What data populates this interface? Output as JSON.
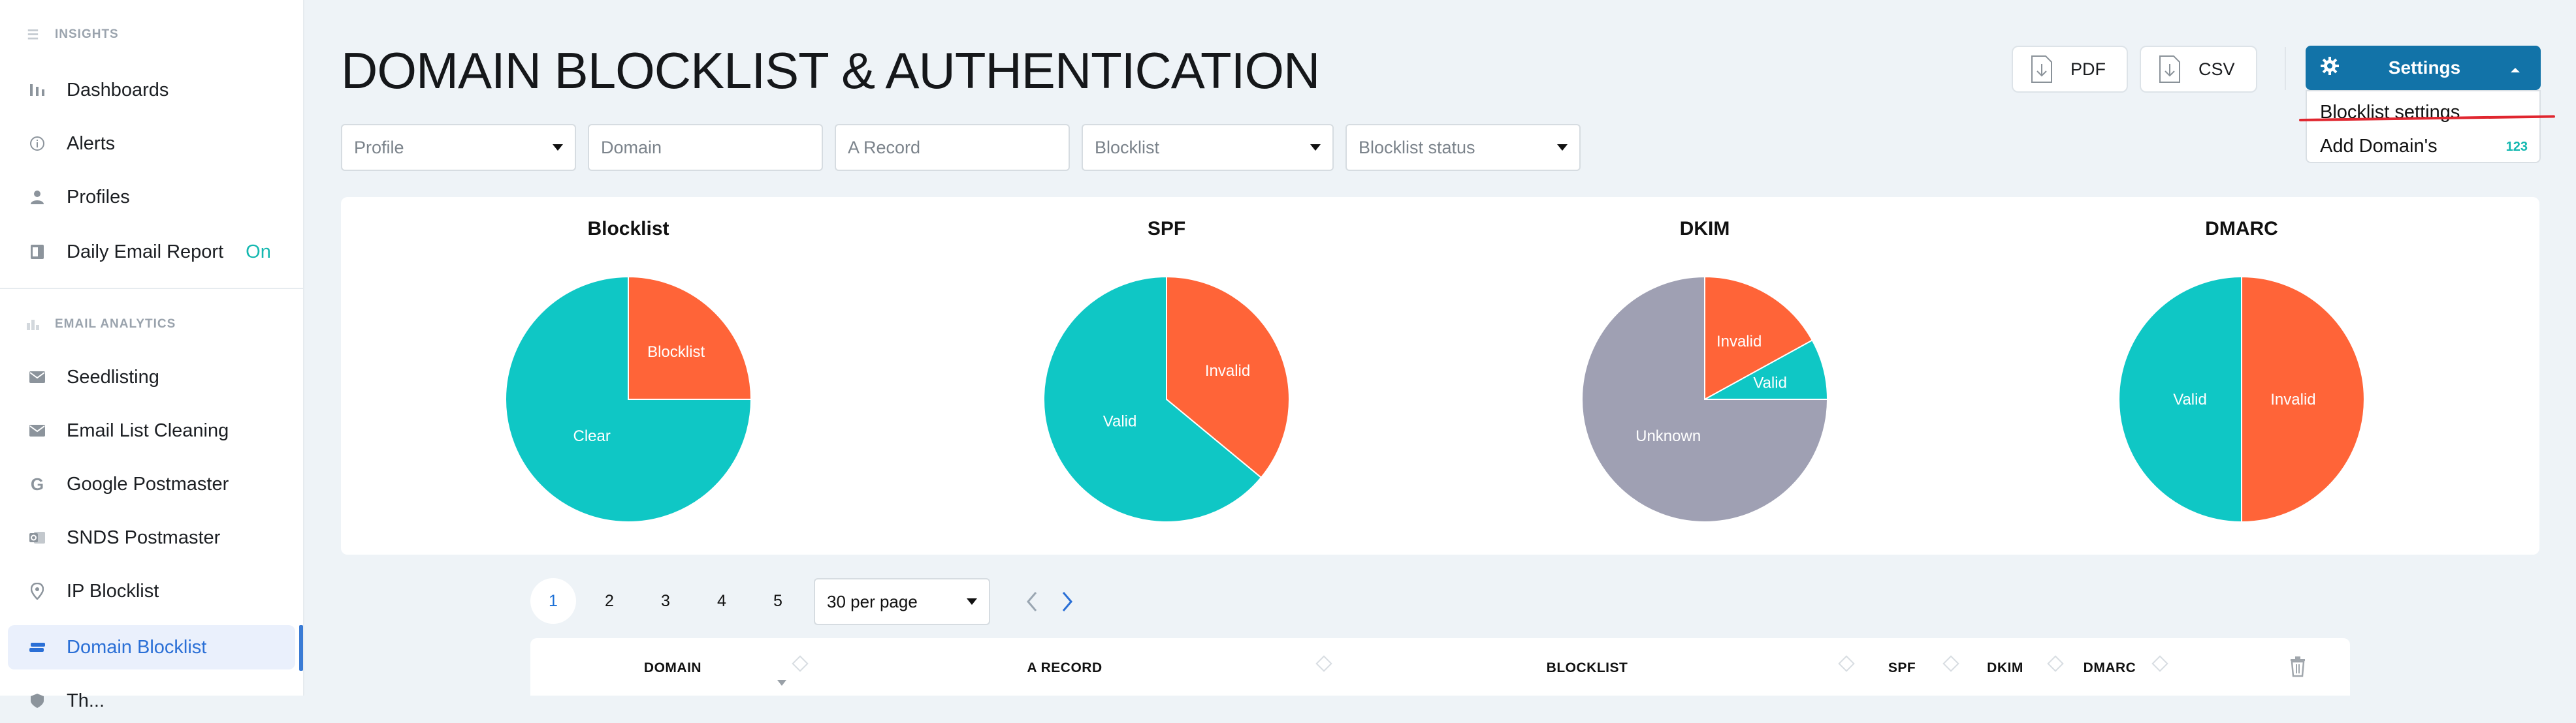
{
  "sidebar": {
    "insights_header": "INSIGHTS",
    "insights_items": [
      {
        "label": "Dashboards",
        "icon": "bar-chart-icon"
      },
      {
        "label": "Alerts",
        "icon": "info-icon"
      },
      {
        "label": "Profiles",
        "icon": "user-icon"
      },
      {
        "label": "Daily Email Report",
        "icon": "report-icon",
        "status": "On"
      }
    ],
    "analytics_header": "EMAIL ANALYTICS",
    "analytics_items": [
      {
        "label": "Seedlisting",
        "icon": "mail-icon"
      },
      {
        "label": "Email List Cleaning",
        "icon": "mail-icon"
      },
      {
        "label": "Google Postmaster",
        "icon": "google-icon"
      },
      {
        "label": "SNDS Postmaster",
        "icon": "outlook-icon"
      },
      {
        "label": "IP Blocklist",
        "icon": "location-pin-icon"
      },
      {
        "label": "Domain Blocklist",
        "icon": "domain-icon",
        "active": true
      },
      {
        "label": "Th...",
        "icon": "shield-icon"
      }
    ]
  },
  "header": {
    "title": "DOMAIN BLOCKLIST & AUTHENTICATION",
    "pdf_label": "PDF",
    "csv_label": "CSV",
    "settings_label": "Settings"
  },
  "settings_menu": {
    "items": [
      {
        "label": "Blocklist settings"
      },
      {
        "label": "Add Domain's",
        "count": "123"
      }
    ]
  },
  "filters": {
    "profile": "Profile",
    "domain": "Domain",
    "a_record": "A Record",
    "blocklist": "Blocklist",
    "blocklist_status": "Blocklist status"
  },
  "chart_data": [
    {
      "type": "pie",
      "title": "Blocklist",
      "slices": [
        {
          "label": "Blocklist",
          "value": 25,
          "color": "#ff6438"
        },
        {
          "label": "Clear",
          "value": 75,
          "color": "#0fc7c5"
        }
      ]
    },
    {
      "type": "pie",
      "title": "SPF",
      "slices": [
        {
          "label": "Invalid",
          "value": 36,
          "color": "#ff6438"
        },
        {
          "label": "Valid",
          "value": 64,
          "color": "#0fc7c5"
        }
      ]
    },
    {
      "type": "pie",
      "title": "DKIM",
      "slices": [
        {
          "label": "Invalid",
          "value": 17,
          "color": "#ff6438"
        },
        {
          "label": "Valid",
          "value": 8,
          "color": "#0fc7c5"
        },
        {
          "label": "Unknown",
          "value": 75,
          "color": "#9fa0b3"
        }
      ]
    },
    {
      "type": "pie",
      "title": "DMARC",
      "slices": [
        {
          "label": "Invalid",
          "value": 50,
          "color": "#ff6438"
        },
        {
          "label": "Valid",
          "value": 50,
          "color": "#0fc7c5"
        }
      ]
    }
  ],
  "pagination": {
    "pages": [
      "1",
      "2",
      "3",
      "4",
      "5"
    ],
    "current": "1",
    "per_page": "30 per page"
  },
  "table": {
    "columns": [
      "DOMAIN",
      "A RECORD",
      "BLOCKLIST",
      "SPF",
      "DKIM",
      "DMARC"
    ]
  },
  "colors": {
    "accent": "#1273a8",
    "teal": "#0fc7c5",
    "orange": "#ff6438",
    "gray": "#9fa0b3",
    "annotation_red": "#e0262f"
  }
}
